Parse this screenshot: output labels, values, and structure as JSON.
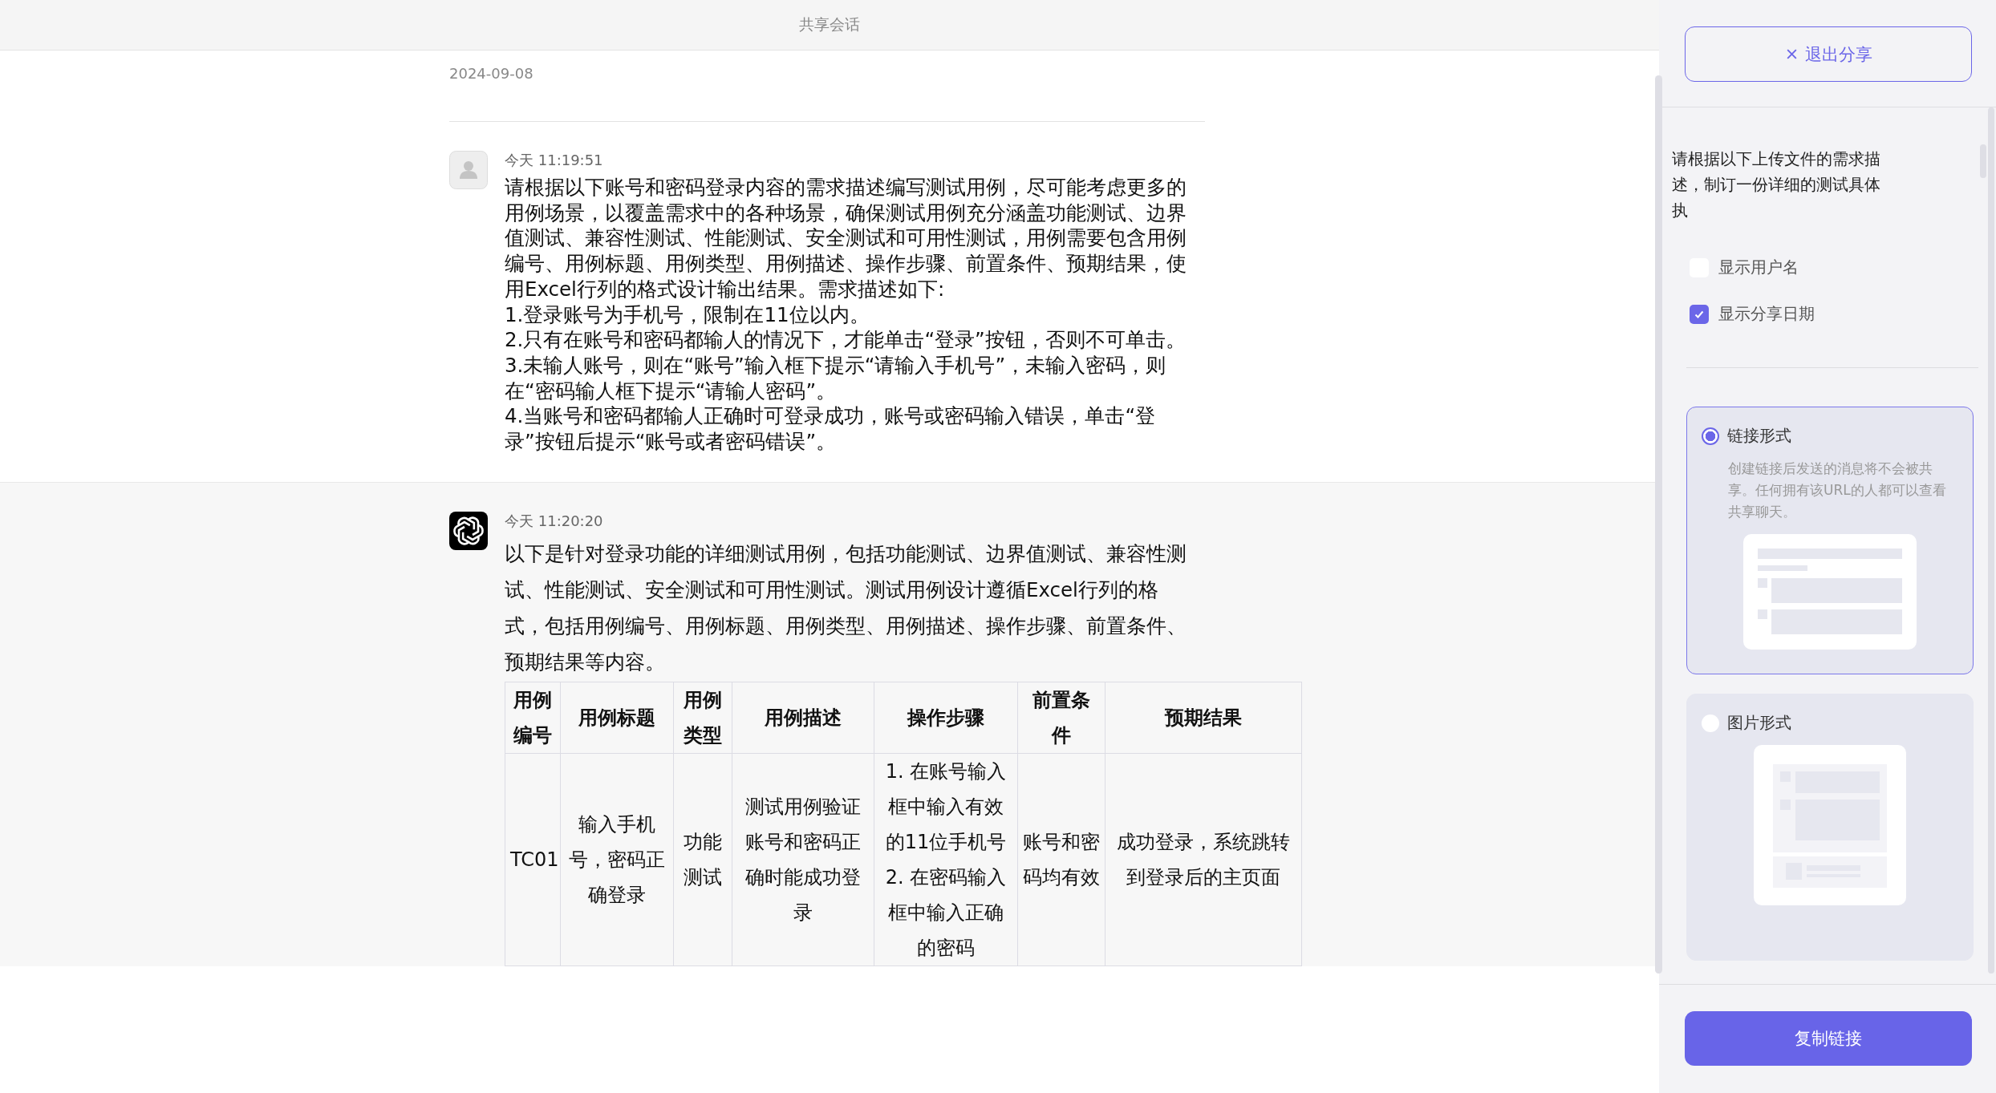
{
  "header": {
    "title": "共享会话"
  },
  "conversation": {
    "date": "2024-09-08",
    "messages": [
      {
        "kind": "user",
        "time": "今天 11:19:51",
        "lines": [
          "请根据以下账号和密码登录内容的需求描述编写测试用例，尽可能考虑更多的用例场景，以覆盖需求中的各种场景，确保测试用例充分涵盖功能测试、边界值测试、兼容性测试、性能测试、安全测试和可用性测试，用例需要包含用例编号、用例标题、用例类型、用例描述、操作步骤、前置条件、预期结果，使用Excel行列的格式设计输出结果。需求描述如下:",
          "1.登录账号为手机号，限制在11位以内。",
          "2.只有在账号和密码都输人的情况下，才能单击“登录”按钮，否则不可单击。",
          "3.未输人账号，则在“账号”输入框下提示“请输入手机号”，未输入密码，则在“密码输人框下提示“请输人密码”。",
          "4.当账号和密码都输人正确时可登录成功，账号或密码输入错误，单击“登录”按钮后提示“账号或者密码错误”。"
        ]
      },
      {
        "kind": "assistant",
        "time": "今天 11:20:20",
        "lines": [
          "以下是针对登录功能的详细测试用例，包括功能测试、边界值测试、兼容性测试、性能测试、安全测试和可用性测试。测试用例设计遵循Excel行列的格式，包括用例编号、用例标题、用例类型、用例描述、操作步骤、前置条件、预期结果等内容。"
        ],
        "table": {
          "columns": [
            "用例编号",
            "用例标题",
            "用例类型",
            "用例描述",
            "操作步骤",
            "前置条件",
            "预期结果"
          ],
          "rows": [
            [
              "TC01",
              "输入手机号，密码正确登录",
              "功能测试",
              "测试用例验证账号和密码正确时能成功登录",
              "1. 在账号输入框中输入有效的11位手机号\n2. 在密码输入框中输入正确的密码",
              "账号和密码均有效",
              "成功登录，系统跳转到登录后的主页面"
            ]
          ]
        }
      }
    ]
  },
  "share_panel": {
    "exit_button": "退出分享",
    "description": "请根据以下上传文件的需求描述，制订一份详细的测试具体执",
    "options": [
      {
        "label": "显示用户名",
        "checked": false
      },
      {
        "label": "显示分享日期",
        "checked": true
      }
    ],
    "formats": [
      {
        "kind": "link",
        "label": "链接形式",
        "selected": true,
        "description": "创建链接后发送的消息将不会被共享。任何拥有该URL的人都可以查看共享聊天。"
      },
      {
        "kind": "image",
        "label": "图片形式",
        "selected": false
      }
    ],
    "copy_button": "复制链接"
  }
}
